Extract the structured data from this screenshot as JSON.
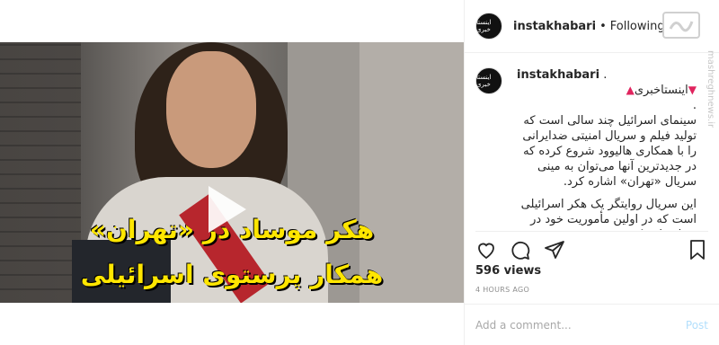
{
  "video": {
    "caption_line1": "هکر موساد در «تهران»",
    "caption_line2": "همکار پرستوی اسرائیلی"
  },
  "header": {
    "avatar_text": "اینستا خبری",
    "username": "instakhabari",
    "separator": "•",
    "follow_status": "Following"
  },
  "watermark": {
    "text": "mashreghnews.ir"
  },
  "post": {
    "avatar_text": "اینستا خبری",
    "username": "instakhabari",
    "username_suffix": ".",
    "title": "اینستاخبری",
    "dot_line": ".",
    "paragraph1": "سینمای اسرائیل چند سالی است که تولید فیلم و سریال امنیتی ضدایرانی را با همکاری هالیوود شروع کرده که در جدیدترین آنها می‌توان به مینی سریال «تهران» اشاره کرد.",
    "paragraph2": "این سریال روایتگر یک هکر اسرائیلی است که در اولین مأموریت خود در تهران باید یک"
  },
  "actions": {
    "icons": [
      "heart-icon",
      "comment-icon",
      "share-icon",
      "bookmark-icon"
    ]
  },
  "stats": {
    "views": "596 views",
    "time": "4 HOURS AGO"
  },
  "add_comment": {
    "placeholder": "Add a comment...",
    "post_label": "Post"
  },
  "colors": {
    "accent_red": "#e0245e",
    "post_button": "#b2dffc",
    "caption_yellow": "#ffe600"
  }
}
